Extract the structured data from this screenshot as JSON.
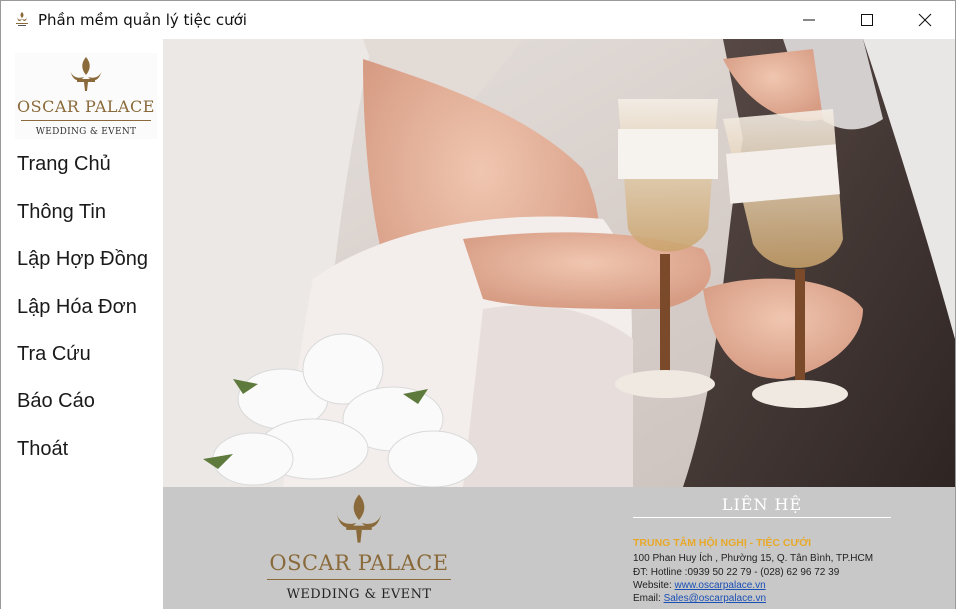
{
  "window": {
    "title": "Phần mềm quản lý tiệc cưới",
    "controls": {
      "minimize": "minimize",
      "maximize": "maximize",
      "close": "close"
    }
  },
  "sidebar": {
    "logo": {
      "brand": "OSCAR PALACE",
      "tagline": "WEDDING & EVENT"
    },
    "items": [
      {
        "label": "Trang Chủ"
      },
      {
        "label": "Thông Tin"
      },
      {
        "label": "Lập Hợp Đồng"
      },
      {
        "label": "Lập Hóa Đơn"
      },
      {
        "label": "Tra Cứu"
      },
      {
        "label": "Báo Cáo"
      },
      {
        "label": "Thoát"
      }
    ]
  },
  "footer": {
    "logo": {
      "brand": "OSCAR PALACE",
      "tagline": "WEDDING & EVENT"
    },
    "contact": {
      "heading": "LIÊN HỆ",
      "subheading": "TRUNG TÂM HỘI NGHỊ - TIỆC CƯỚI",
      "address": "100 Phan Huy Ích , Phường 15, Q. Tân Bình, TP.HCM",
      "hotline": "ĐT: Hotline :0939 50 22 79 - (028) 62 96 72 39",
      "website_label": "Website:",
      "website": "www.oscarpalace.vn",
      "email_label": "Email:",
      "email": "Sales@oscarpalace.vn"
    }
  },
  "colors": {
    "brand_gold": "#8a6a3a",
    "contact_orange": "#e8a92a",
    "link_blue": "#1a4fb5",
    "footer_bg": "#c8c8c8"
  },
  "icons": {
    "app": "app-logo-icon",
    "logo_emblem": "fleur-de-lis-icon"
  }
}
